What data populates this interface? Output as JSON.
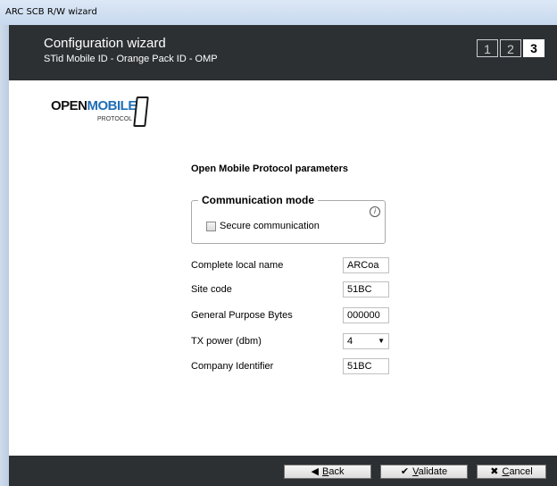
{
  "window": {
    "title": "ARC SCB R/W wizard"
  },
  "header": {
    "title": "Configuration wizard",
    "subtitle": "STid Mobile ID - Orange Pack ID - OMP",
    "steps": [
      "1",
      "2",
      "3"
    ]
  },
  "logo": {
    "word1": "OPEN",
    "word2": "MOBILE",
    "word3": "PROTOCOL"
  },
  "section": {
    "title": "Open Mobile Protocol parameters"
  },
  "comm_mode": {
    "legend": "Communication mode",
    "info": "i",
    "secure_label": "Secure communication",
    "secure_checked": false
  },
  "fields": {
    "local_name": {
      "label": "Complete local name",
      "value": "ARCoa"
    },
    "site_code": {
      "label": "Site code",
      "value": "51BC"
    },
    "gp_bytes": {
      "label": "General Purpose Bytes",
      "value": "000000"
    },
    "tx_power": {
      "label": "TX power (dbm)",
      "value": "4"
    },
    "company_id": {
      "label": "Company Identifier",
      "value": "51BC"
    }
  },
  "footer": {
    "back": {
      "prefix": "B",
      "rest": "ack"
    },
    "validate": {
      "prefix": "V",
      "rest": "alidate"
    },
    "cancel": {
      "prefix": "C",
      "rest": "ancel"
    }
  },
  "colors": {
    "header_bg": "#2c3033",
    "accent_blue": "#1f6fb7"
  }
}
